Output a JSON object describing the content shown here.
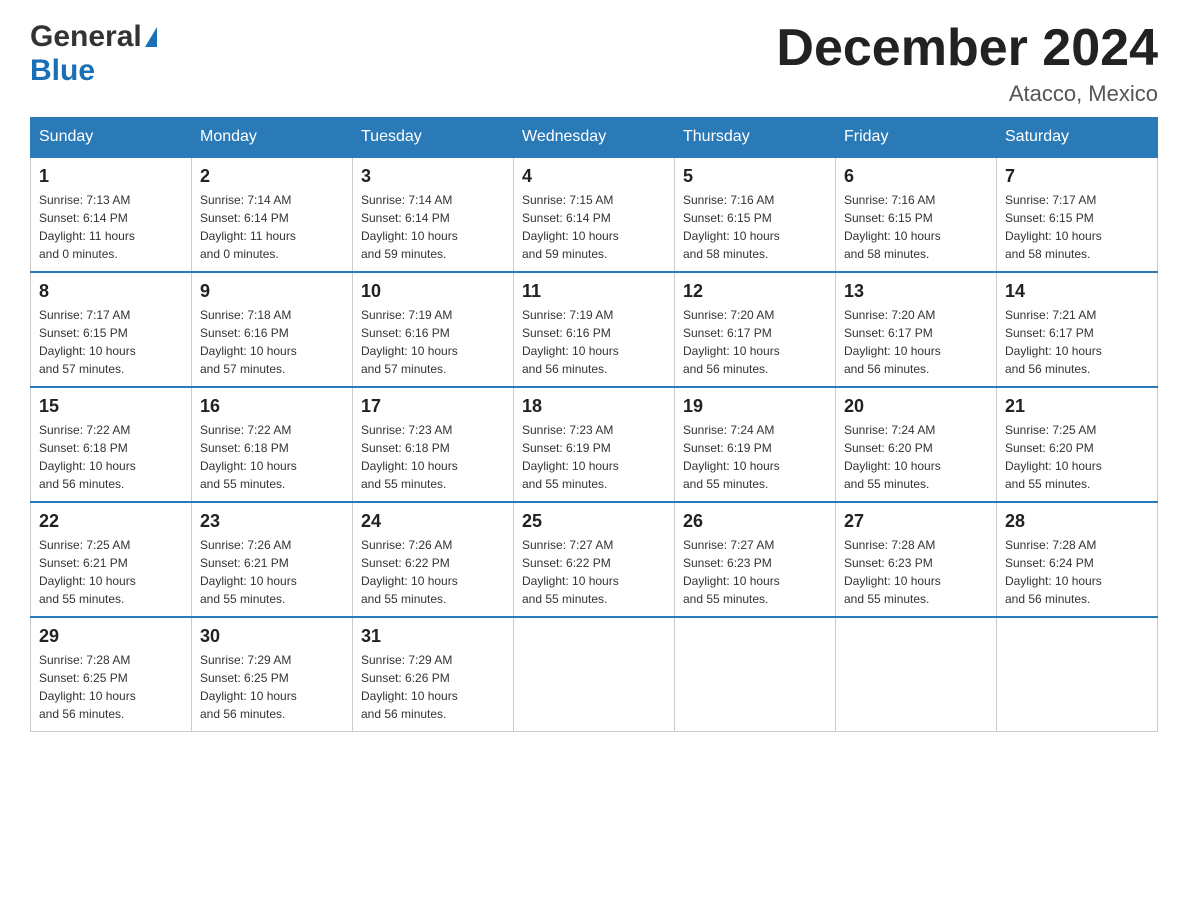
{
  "header": {
    "logo_general": "General",
    "logo_blue": "Blue",
    "title": "December 2024",
    "subtitle": "Atacco, Mexico"
  },
  "days_of_week": [
    "Sunday",
    "Monday",
    "Tuesday",
    "Wednesday",
    "Thursday",
    "Friday",
    "Saturday"
  ],
  "weeks": [
    [
      {
        "day": "1",
        "sunrise": "7:13 AM",
        "sunset": "6:14 PM",
        "daylight": "11 hours and 0 minutes."
      },
      {
        "day": "2",
        "sunrise": "7:14 AM",
        "sunset": "6:14 PM",
        "daylight": "11 hours and 0 minutes."
      },
      {
        "day": "3",
        "sunrise": "7:14 AM",
        "sunset": "6:14 PM",
        "daylight": "10 hours and 59 minutes."
      },
      {
        "day": "4",
        "sunrise": "7:15 AM",
        "sunset": "6:14 PM",
        "daylight": "10 hours and 59 minutes."
      },
      {
        "day": "5",
        "sunrise": "7:16 AM",
        "sunset": "6:15 PM",
        "daylight": "10 hours and 58 minutes."
      },
      {
        "day": "6",
        "sunrise": "7:16 AM",
        "sunset": "6:15 PM",
        "daylight": "10 hours and 58 minutes."
      },
      {
        "day": "7",
        "sunrise": "7:17 AM",
        "sunset": "6:15 PM",
        "daylight": "10 hours and 58 minutes."
      }
    ],
    [
      {
        "day": "8",
        "sunrise": "7:17 AM",
        "sunset": "6:15 PM",
        "daylight": "10 hours and 57 minutes."
      },
      {
        "day": "9",
        "sunrise": "7:18 AM",
        "sunset": "6:16 PM",
        "daylight": "10 hours and 57 minutes."
      },
      {
        "day": "10",
        "sunrise": "7:19 AM",
        "sunset": "6:16 PM",
        "daylight": "10 hours and 57 minutes."
      },
      {
        "day": "11",
        "sunrise": "7:19 AM",
        "sunset": "6:16 PM",
        "daylight": "10 hours and 56 minutes."
      },
      {
        "day": "12",
        "sunrise": "7:20 AM",
        "sunset": "6:17 PM",
        "daylight": "10 hours and 56 minutes."
      },
      {
        "day": "13",
        "sunrise": "7:20 AM",
        "sunset": "6:17 PM",
        "daylight": "10 hours and 56 minutes."
      },
      {
        "day": "14",
        "sunrise": "7:21 AM",
        "sunset": "6:17 PM",
        "daylight": "10 hours and 56 minutes."
      }
    ],
    [
      {
        "day": "15",
        "sunrise": "7:22 AM",
        "sunset": "6:18 PM",
        "daylight": "10 hours and 56 minutes."
      },
      {
        "day": "16",
        "sunrise": "7:22 AM",
        "sunset": "6:18 PM",
        "daylight": "10 hours and 55 minutes."
      },
      {
        "day": "17",
        "sunrise": "7:23 AM",
        "sunset": "6:18 PM",
        "daylight": "10 hours and 55 minutes."
      },
      {
        "day": "18",
        "sunrise": "7:23 AM",
        "sunset": "6:19 PM",
        "daylight": "10 hours and 55 minutes."
      },
      {
        "day": "19",
        "sunrise": "7:24 AM",
        "sunset": "6:19 PM",
        "daylight": "10 hours and 55 minutes."
      },
      {
        "day": "20",
        "sunrise": "7:24 AM",
        "sunset": "6:20 PM",
        "daylight": "10 hours and 55 minutes."
      },
      {
        "day": "21",
        "sunrise": "7:25 AM",
        "sunset": "6:20 PM",
        "daylight": "10 hours and 55 minutes."
      }
    ],
    [
      {
        "day": "22",
        "sunrise": "7:25 AM",
        "sunset": "6:21 PM",
        "daylight": "10 hours and 55 minutes."
      },
      {
        "day": "23",
        "sunrise": "7:26 AM",
        "sunset": "6:21 PM",
        "daylight": "10 hours and 55 minutes."
      },
      {
        "day": "24",
        "sunrise": "7:26 AM",
        "sunset": "6:22 PM",
        "daylight": "10 hours and 55 minutes."
      },
      {
        "day": "25",
        "sunrise": "7:27 AM",
        "sunset": "6:22 PM",
        "daylight": "10 hours and 55 minutes."
      },
      {
        "day": "26",
        "sunrise": "7:27 AM",
        "sunset": "6:23 PM",
        "daylight": "10 hours and 55 minutes."
      },
      {
        "day": "27",
        "sunrise": "7:28 AM",
        "sunset": "6:23 PM",
        "daylight": "10 hours and 55 minutes."
      },
      {
        "day": "28",
        "sunrise": "7:28 AM",
        "sunset": "6:24 PM",
        "daylight": "10 hours and 56 minutes."
      }
    ],
    [
      {
        "day": "29",
        "sunrise": "7:28 AM",
        "sunset": "6:25 PM",
        "daylight": "10 hours and 56 minutes."
      },
      {
        "day": "30",
        "sunrise": "7:29 AM",
        "sunset": "6:25 PM",
        "daylight": "10 hours and 56 minutes."
      },
      {
        "day": "31",
        "sunrise": "7:29 AM",
        "sunset": "6:26 PM",
        "daylight": "10 hours and 56 minutes."
      },
      null,
      null,
      null,
      null
    ]
  ],
  "labels": {
    "sunrise": "Sunrise:",
    "sunset": "Sunset:",
    "daylight": "Daylight:"
  }
}
